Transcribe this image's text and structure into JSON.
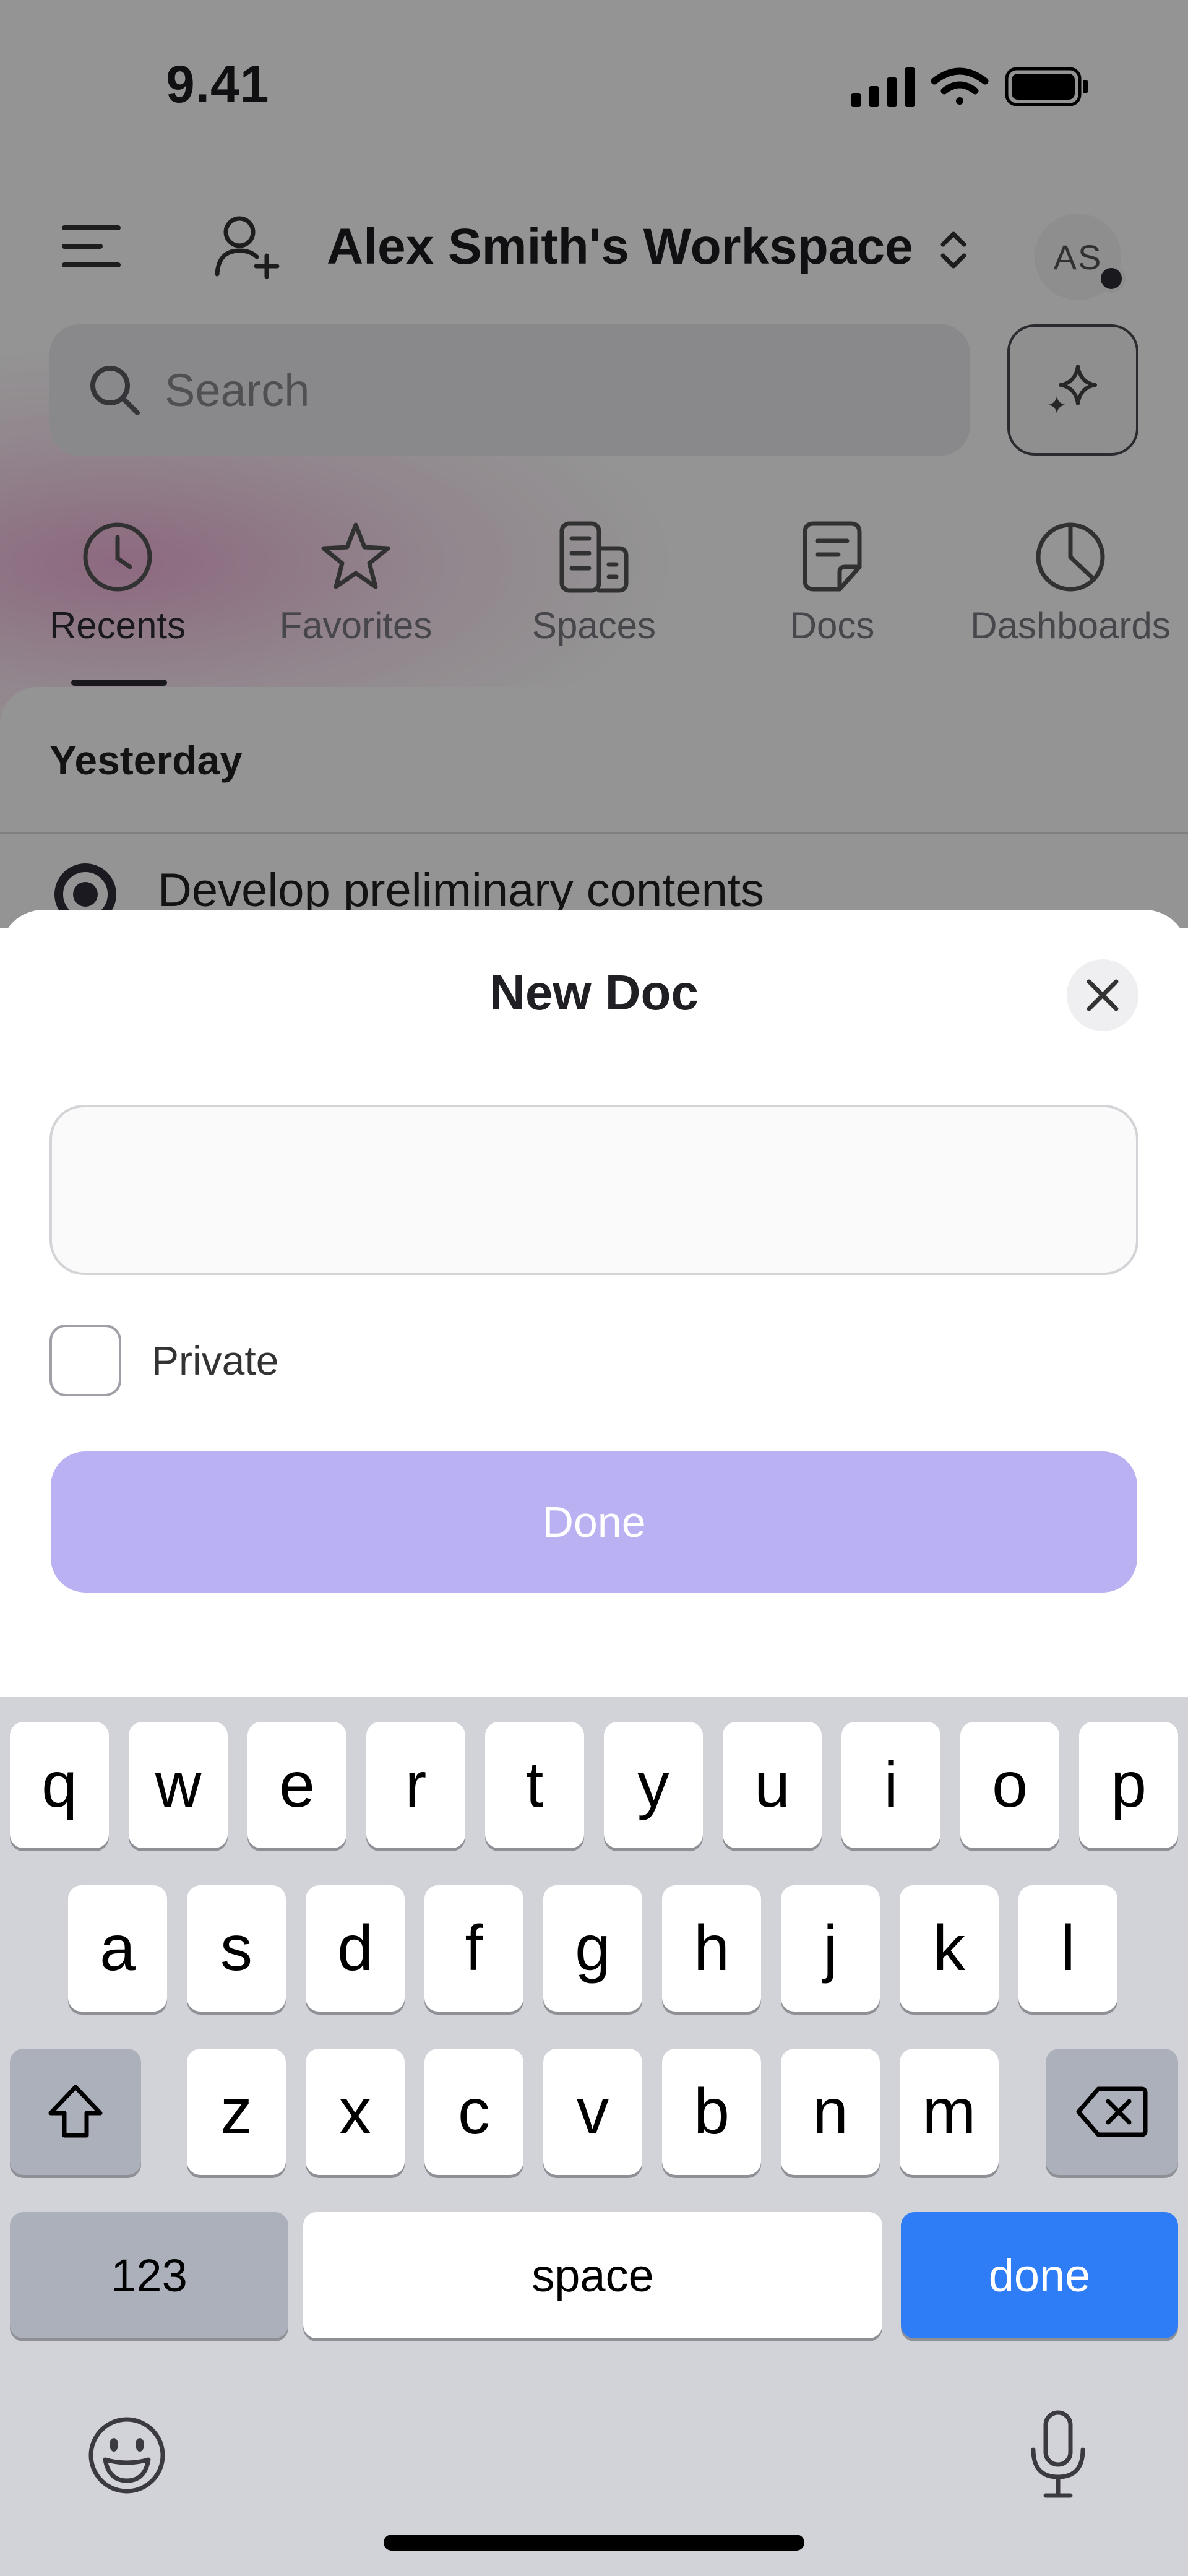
{
  "status_bar": {
    "time": "9.41"
  },
  "workspace": {
    "name": "Alex Smith's Workspace",
    "avatar_initials": "AS"
  },
  "search": {
    "placeholder": "Search"
  },
  "tabs": [
    {
      "label": "Recents",
      "icon": "clock-icon",
      "active": true
    },
    {
      "label": "Favorites",
      "icon": "star-icon",
      "active": false
    },
    {
      "label": "Spaces",
      "icon": "spaces-icon",
      "active": false
    },
    {
      "label": "Docs",
      "icon": "doc-icon",
      "active": false
    },
    {
      "label": "Dashboards",
      "icon": "pie-chart-icon",
      "active": false
    }
  ],
  "recents": {
    "section": "Yesterday",
    "items": [
      {
        "title": "Develop preliminary contents"
      }
    ]
  },
  "sheet": {
    "title": "New Doc",
    "name_value": "",
    "private_label": "Private",
    "private_checked": false,
    "done_label": "Done"
  },
  "keyboard": {
    "row1": [
      "q",
      "w",
      "e",
      "r",
      "t",
      "y",
      "u",
      "i",
      "o",
      "p"
    ],
    "row2": [
      "a",
      "s",
      "d",
      "f",
      "g",
      "h",
      "j",
      "k",
      "l"
    ],
    "row3": [
      "z",
      "x",
      "c",
      "v",
      "b",
      "n",
      "m"
    ],
    "numbers_label": "123",
    "space_label": "space",
    "return_label": "done"
  },
  "colors": {
    "accent_disabled": "#b9b1f2",
    "keyboard_return": "#2f7df6",
    "keyboard_bg": "#d2d3d9"
  }
}
